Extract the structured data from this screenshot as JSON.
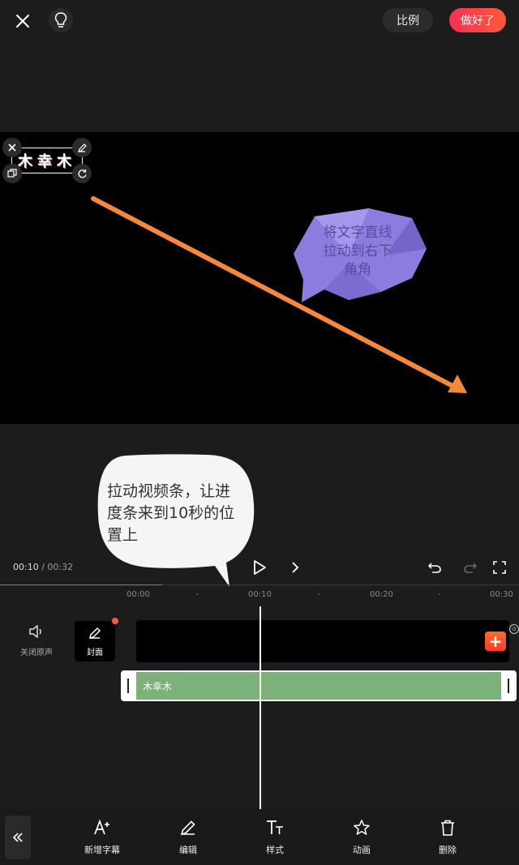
{
  "topbar": {
    "ratio_label": "比例",
    "done_label": "做好了"
  },
  "preview": {
    "title_text": "木幸木",
    "annotation_purple": "将文字直线拉动到右下角角",
    "annotation_white": "拉动视频条，让进度条来到10秒的位置上",
    "arrow_color": "#f5893b",
    "bubble_color": "#8b7de0"
  },
  "playback": {
    "current_time": "00:10",
    "separator": "/",
    "total_time": "00:32"
  },
  "ruler": {
    "labels": [
      "00:00",
      "00:10",
      "00:20",
      "00:30"
    ]
  },
  "tracks": {
    "mute_label": "关闭原声",
    "cover_label": "封面",
    "text_clip_label": "木幸木",
    "text_clip_color": "#7cb27a",
    "add_badge": "+"
  },
  "toolbar": {
    "items": [
      {
        "label": "新增字幕",
        "icon": "add-text-icon"
      },
      {
        "label": "编辑",
        "icon": "pencil-icon"
      },
      {
        "label": "样式",
        "icon": "text-style-icon"
      },
      {
        "label": "动画",
        "icon": "star-icon"
      },
      {
        "label": "删除",
        "icon": "trash-icon"
      }
    ]
  },
  "colors": {
    "accent": "#ff3a44",
    "background": "#1c1c1c"
  }
}
